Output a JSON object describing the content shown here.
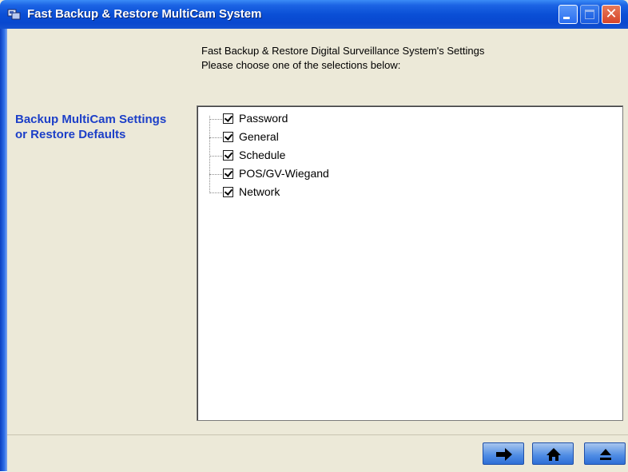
{
  "window": {
    "title": "Fast Backup & Restore MultiCam System",
    "titlebar_color": "#0a4fd6",
    "controls": [
      "minimize-icon",
      "maximize-icon",
      "close-icon"
    ],
    "close_glyph": "✕"
  },
  "sidebar": {
    "heading": "Backup MultiCam Settings or Restore Defaults",
    "heading_color": "#1c3fc8"
  },
  "header": {
    "line1": "Fast Backup & Restore Digital Surveillance System's Settings",
    "line2": "Please choose one of the selections below:"
  },
  "tree": {
    "items": [
      {
        "label": "Password",
        "checked": true
      },
      {
        "label": "General",
        "checked": true
      },
      {
        "label": "Schedule",
        "checked": true
      },
      {
        "label": "POS/GV-Wiegand",
        "checked": true
      },
      {
        "label": "Network",
        "checked": true
      }
    ]
  },
  "nav_buttons": [
    {
      "icon": "right-arrow-icon"
    },
    {
      "icon": "home-icon"
    },
    {
      "icon": "eject-icon"
    }
  ]
}
